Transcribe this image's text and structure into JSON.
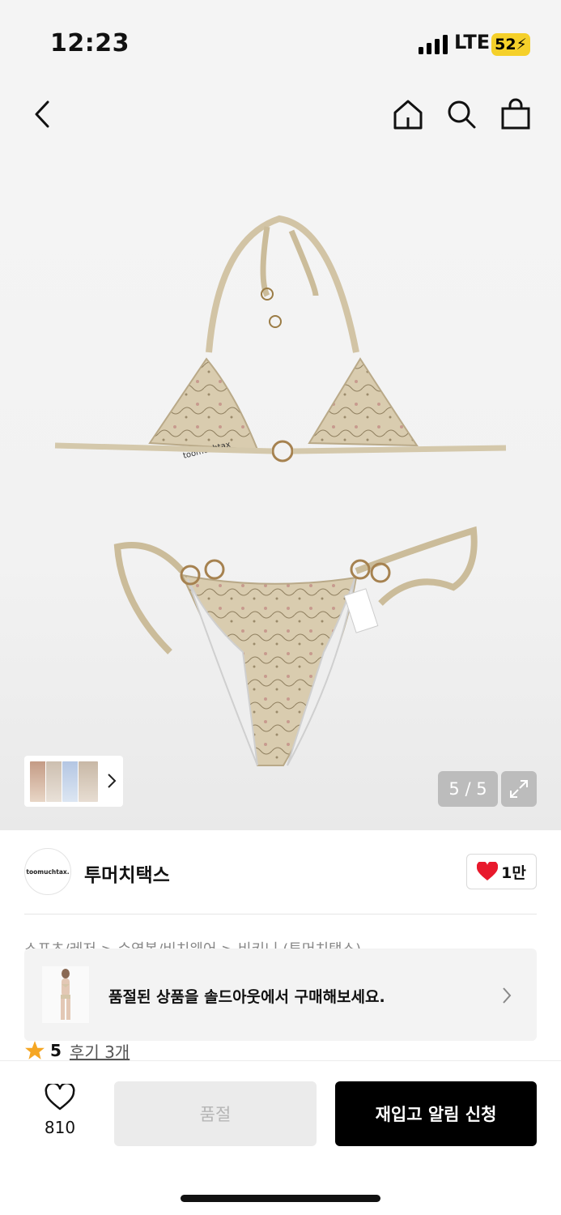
{
  "status_bar": {
    "time": "12:23",
    "network": "LTE",
    "battery": "52"
  },
  "nav": {
    "back_icon": "chevron-left-icon",
    "home_icon": "home-icon",
    "search_icon": "search-icon",
    "cart_icon": "shopping-bag-icon"
  },
  "gallery": {
    "page_indicator": "5 / 5",
    "print_text": "toomuchtax"
  },
  "brand": {
    "logo_text": "toomuchtax.",
    "name": "투머치택스",
    "like_count": "1만"
  },
  "breadcrumb": "스포츠/레저 > 수영복/비치웨어 > 비키니 (투머치택스)",
  "soldout_banner": {
    "text": "품절된 상품을 솔드아웃에서 구매해보세요."
  },
  "rating": {
    "score": "5",
    "reviews": "후기 3개"
  },
  "bottom_bar": {
    "wish_count": "810",
    "soldout_label": "품절",
    "restock_label": "재입고 알림 신청"
  },
  "colors": {
    "accent_black": "#000000",
    "heart_red": "#e8192c",
    "star": "#f5a623",
    "battery": "#f5d02a"
  }
}
